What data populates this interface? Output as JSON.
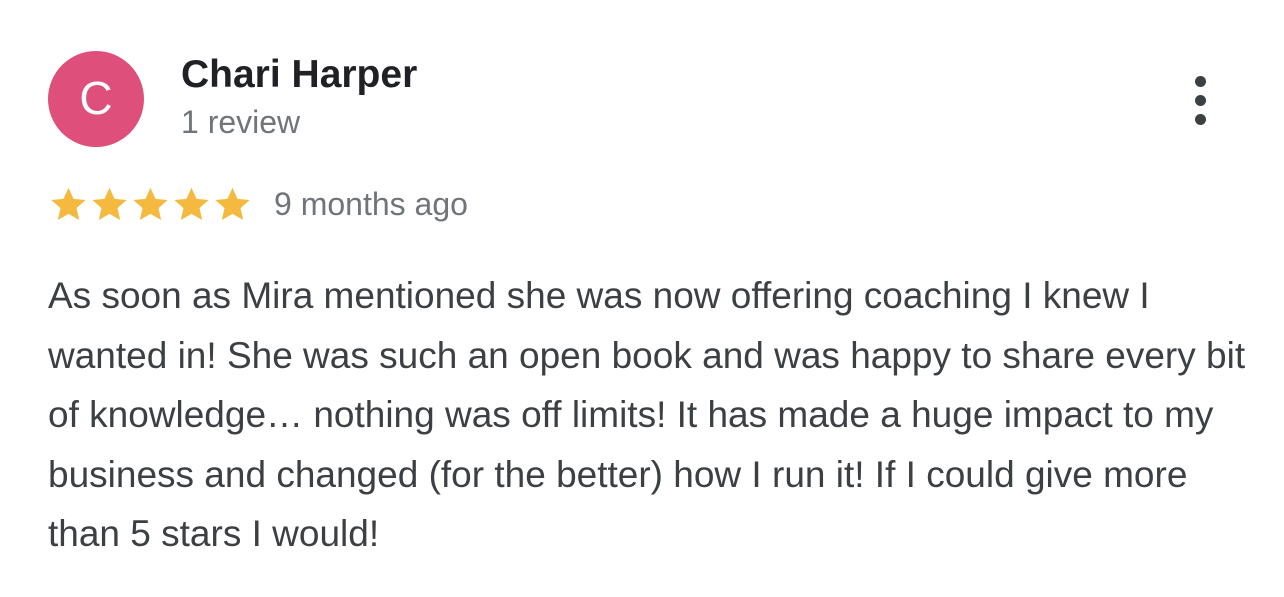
{
  "reviewer": {
    "initial": "C",
    "name": "Chari Harper",
    "review_count": "1 review",
    "avatar_color": "#df4f7b"
  },
  "rating": {
    "stars": 5,
    "max": 5,
    "star_color": "#f4b93e"
  },
  "date": "9 months ago",
  "review_text": "As soon as Mira mentioned she was now offering coaching I knew I wanted in! She was such an open book and was happy to share every bit of knowledge… nothing was off limits! It has made a huge impact to my business and changed (for the better) how I run it! If I could give more than 5 stars I would!",
  "menu": {
    "icon": "more-vert-icon"
  }
}
